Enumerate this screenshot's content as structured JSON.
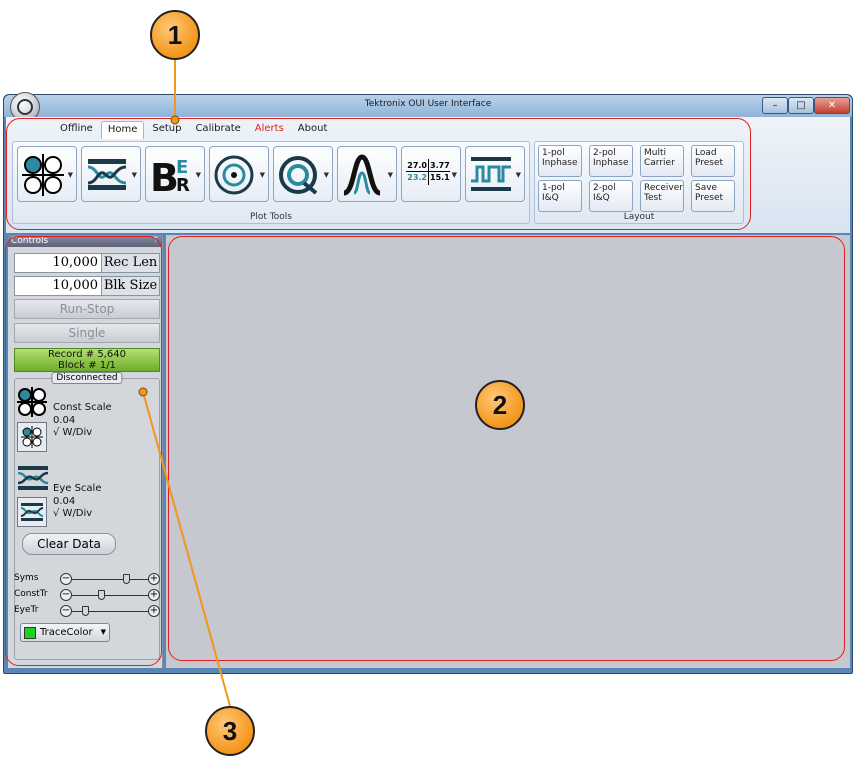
{
  "window": {
    "title": "Tektronix OUI User Interface",
    "minimize": "–",
    "maximize": "□",
    "close": "✕"
  },
  "tabs": [
    "Offline",
    "Home",
    "Setup",
    "Calibrate",
    "Alerts",
    "About"
  ],
  "plot_tools": {
    "group_label": "Plot Tools",
    "numeric_icon": {
      "top_left": "27.0",
      "top_right": "3.77",
      "bottom_left": "23.2",
      "bottom_right": "15.1"
    },
    "icons": [
      "constellation-icon",
      "eye-diagram-icon",
      "ber-icon",
      "circle-plot-icon",
      "q-factor-icon",
      "spectrum-icon",
      "numeric-table-icon",
      "bit-sequence-icon"
    ]
  },
  "layout": {
    "group_label": "Layout",
    "buttons": [
      {
        "line1": "1-pol",
        "line2": "Inphase"
      },
      {
        "line1": "2-pol",
        "line2": "Inphase"
      },
      {
        "line1": "Multi",
        "line2": "Carrier"
      },
      {
        "line1": "Load",
        "line2": "Preset"
      },
      {
        "line1": "1-pol",
        "line2": "I&Q"
      },
      {
        "line1": "2-pol",
        "line2": "I&Q"
      },
      {
        "line1": "Receiver",
        "line2": "Test"
      },
      {
        "line1": "Save",
        "line2": "Preset"
      }
    ]
  },
  "controls": {
    "header": "Controls",
    "pin": "ᛘ",
    "rec_len": {
      "value": "10,000",
      "label": "Rec Len"
    },
    "blk_size": {
      "value": "10,000",
      "label": "Blk Size"
    },
    "run_stop": "Run-Stop",
    "single": "Single",
    "record": "Record # 5,640",
    "block": "Block # 1/1",
    "status": "Disconnected",
    "const_scale": {
      "title": "Const Scale",
      "value": "0.04",
      "unit": "√ W/Div"
    },
    "eye_scale": {
      "title": "Eye Scale",
      "value": "0.04",
      "unit": "√ W/Div"
    },
    "clear_data": "Clear Data",
    "sliders": [
      {
        "label": "Syms",
        "level": 0.8
      },
      {
        "label": "ConstTr",
        "level": 0.4
      },
      {
        "label": "EyeTr",
        "level": 0.15
      }
    ],
    "trace_color": {
      "label": "TraceColor",
      "color": "#1fd11f"
    }
  },
  "annotations": [
    "1",
    "2",
    "3"
  ],
  "colors": {
    "annotation": "#f4951c",
    "highlight": "#e02020",
    "alert_tab": "#e0231c"
  }
}
